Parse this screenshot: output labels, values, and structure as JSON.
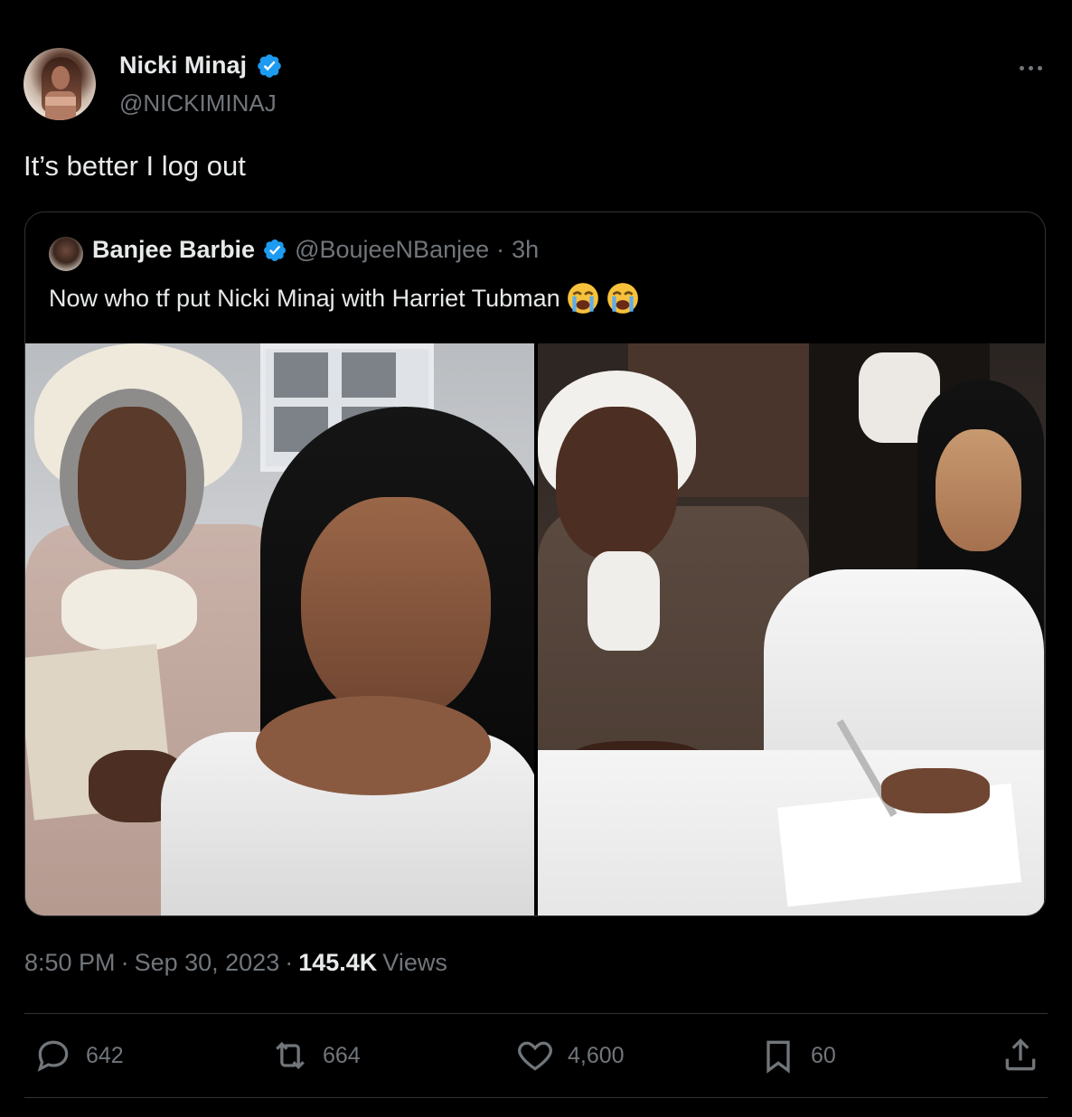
{
  "tweet": {
    "author_name": "Nicki Minaj",
    "author_handle": "@NICKIMINAJ",
    "text": "It’s better I log out",
    "timestamp_time": "8:50 PM",
    "timestamp_date": "Sep 30, 2023",
    "views_count": "145.4K",
    "views_label": "Views"
  },
  "quote": {
    "author_name": "Banjee Barbie",
    "author_handle": "@BoujeeNBanjee",
    "age": "3h",
    "text": "Now who tf put Nicki Minaj with Harriet Tubman",
    "emoji": [
      "loudly-crying-face",
      "loudly-crying-face"
    ]
  },
  "actions": {
    "replies": "642",
    "retweets": "664",
    "likes": "4,600",
    "bookmarks": "60"
  },
  "colors": {
    "background": "#000000",
    "text": "#e7e9ea",
    "muted": "#71767b",
    "border": "#2f3336",
    "verified": "#1d9bf0"
  },
  "separators": {
    "dot": "·"
  }
}
